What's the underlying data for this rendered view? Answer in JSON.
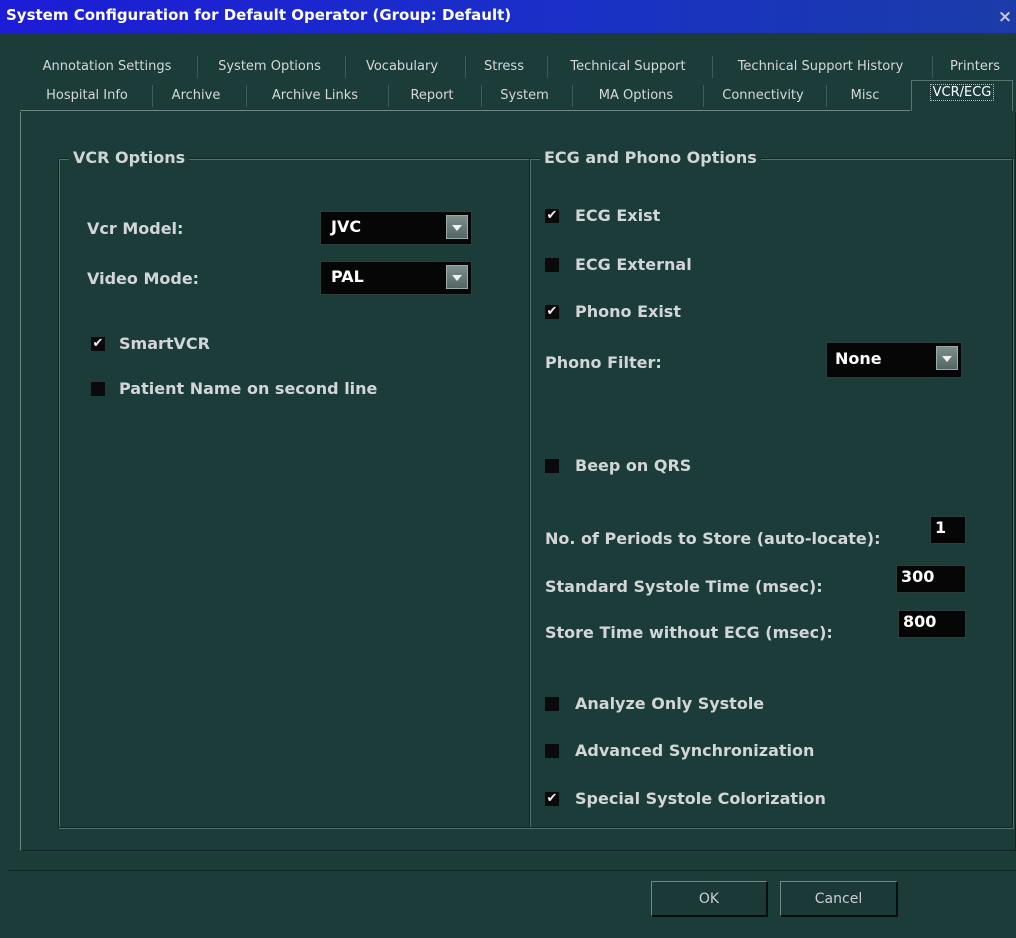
{
  "window": {
    "title": "System Configuration for Default Operator (Group: Default)",
    "close_label": "×"
  },
  "tabs": {
    "row1": [
      {
        "label": "Annotation Settings"
      },
      {
        "label": "System Options"
      },
      {
        "label": "Vocabulary"
      },
      {
        "label": "Stress"
      },
      {
        "label": "Technical Support"
      },
      {
        "label": "Technical Support History"
      },
      {
        "label": "Printers"
      }
    ],
    "row2": [
      {
        "label": "Hospital Info"
      },
      {
        "label": "Archive"
      },
      {
        "label": "Archive Links"
      },
      {
        "label": "Report"
      },
      {
        "label": "System"
      },
      {
        "label": "MA Options"
      },
      {
        "label": "Connectivity"
      },
      {
        "label": "Misc"
      },
      {
        "label": "VCR/ECG",
        "active": true
      }
    ]
  },
  "vcr": {
    "title": "VCR Options",
    "vcr_model_label": "Vcr Model:",
    "vcr_model_value": "JVC",
    "video_mode_label": "Video Mode:",
    "video_mode_value": "PAL",
    "smartvcr_label": "SmartVCR",
    "smartvcr_checked": true,
    "patient_name_label": "Patient Name on second line",
    "patient_name_checked": false
  },
  "ecg": {
    "title": "ECG and Phono Options",
    "ecg_exist_label": "ECG Exist",
    "ecg_exist_checked": true,
    "ecg_external_label": "ECG External",
    "ecg_external_checked": false,
    "phono_exist_label": "Phono Exist",
    "phono_exist_checked": true,
    "phono_filter_label": "Phono Filter:",
    "phono_filter_value": "None",
    "beep_label": "Beep on QRS",
    "beep_checked": false,
    "periods_label": "No. of Periods to Store (auto-locate):",
    "periods_value": "1",
    "systole_time_label": "Standard Systole Time (msec):",
    "systole_time_value": "300",
    "store_time_label": "Store Time without ECG (msec):",
    "store_time_value": "800",
    "analyze_label": "Analyze Only Systole",
    "analyze_checked": false,
    "advanced_sync_label": "Advanced Synchronization",
    "advanced_sync_checked": false,
    "special_color_label": "Special Systole Colorization",
    "special_color_checked": true
  },
  "buttons": {
    "ok_label": "OK",
    "cancel_label": "Cancel"
  },
  "colors": {
    "background": "#1c3c3a",
    "titlebar": "#1d1cd6",
    "field": "#060606"
  }
}
